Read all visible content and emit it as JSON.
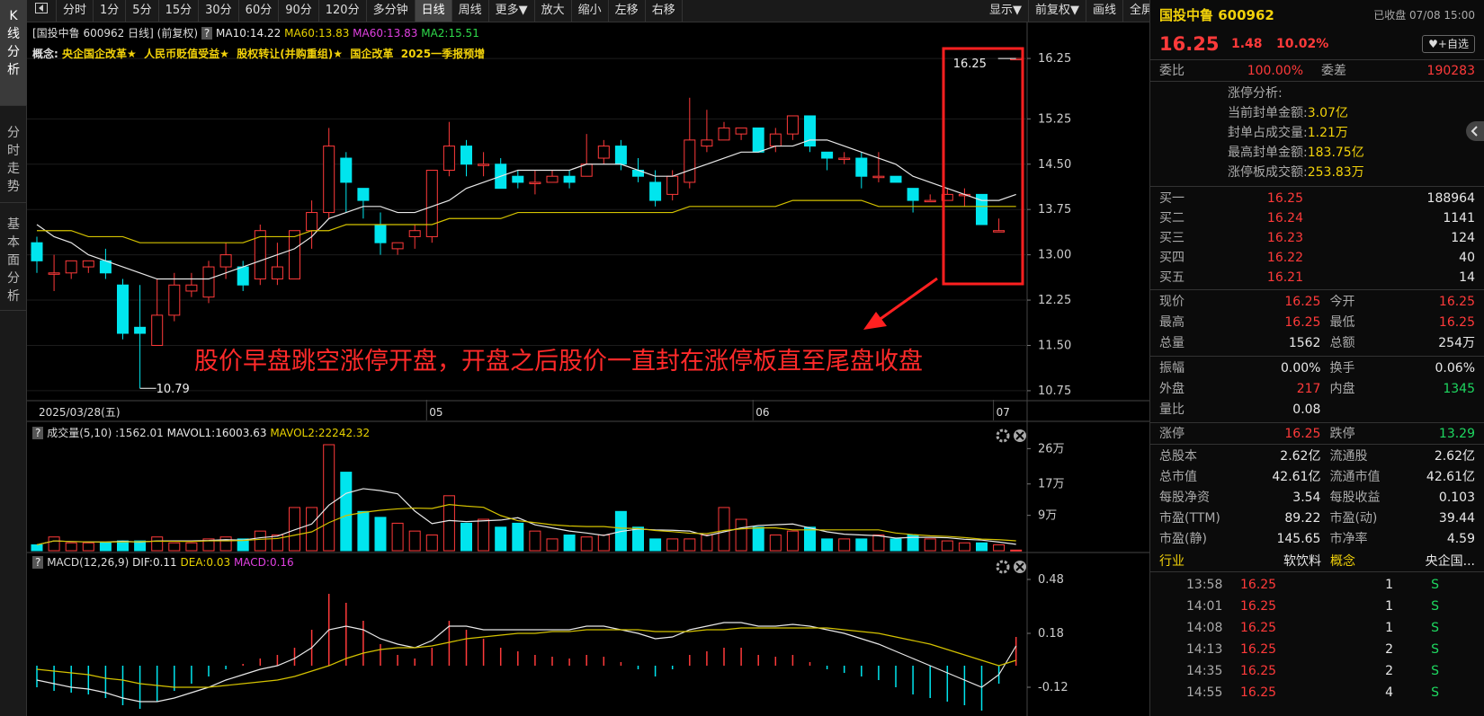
{
  "left_tabs": [
    "K\n线\n分\n析",
    "分\n时\n走\n势",
    "基\n本\n面\n分\n析"
  ],
  "toolbar": {
    "collapse_icon": "collapse-left-icon",
    "periods": [
      "分时",
      "1分",
      "5分",
      "15分",
      "30分",
      "60分",
      "90分",
      "120分",
      "多分钟",
      "日线",
      "周线",
      "更多▼"
    ],
    "active_period": "日线",
    "tools": [
      "放大",
      "缩小",
      "左移",
      "右移"
    ],
    "right_tools": [
      "显示▼",
      "前复权▼",
      "画线",
      "全屏"
    ]
  },
  "kline_header": {
    "title": "[国投中鲁 600962 日线]",
    "adj": "(前复权)",
    "help": "?",
    "ma10": "MA10:14.22",
    "ma60": "MA60:13.83",
    "ma60b": "MA60:13.83",
    "ma2": "MA2:15.51"
  },
  "concepts": {
    "label": "概念:",
    "items": [
      "央企国企改革★",
      "人民币贬值受益★",
      "股权转让(并购重组)★",
      "国企改革",
      "2025一季报预增"
    ]
  },
  "annotation": "股价早盘跳空涨停开盘，开盘之后股价一直封在涨停板直至尾盘收盘",
  "price_labels": {
    "high": "16.25",
    "low": "10.79"
  },
  "price_axis": [
    "16.25",
    "15.25",
    "14.50",
    "13.75",
    "13.00",
    "12.25",
    "11.50",
    "10.75"
  ],
  "date_axis": {
    "start": "2025/03/28(五)",
    "m1": "05",
    "m2": "06",
    "m3": "07"
  },
  "volume_header": {
    "help": "?",
    "title": "成交量(5,10)",
    "val": ":1562.01",
    "mavol1": "MAVOL1:16003.63",
    "mavol2": "MAVOL2:22242.32"
  },
  "volume_axis": [
    "26万",
    "17万",
    "9万"
  ],
  "macd_header": {
    "help": "?",
    "title": "MACD(12,26,9)",
    "dif": "DIF:0.11",
    "dea": "DEA:0.03",
    "macd": "MACD:0.16"
  },
  "macd_axis": [
    "0.48",
    "0.18",
    "-0.12"
  ],
  "colors": {
    "up": "#ff3a3a",
    "down": "#00e5ee",
    "ma_white": "#e8e8e8",
    "ma_yellow": "#d4c200",
    "highlight": "#ff2020"
  },
  "chart_data": {
    "type": "candlestick",
    "price_axis": {
      "ylim": [
        10.6,
        16.4
      ],
      "ticks": [
        16.25,
        15.25,
        14.5,
        13.75,
        13.0,
        12.25,
        11.5,
        10.75
      ]
    },
    "candles": [
      [
        13.2,
        12.9,
        13.3,
        12.7
      ],
      [
        12.7,
        12.7,
        13.0,
        12.4
      ],
      [
        12.7,
        12.9,
        12.9,
        12.6
      ],
      [
        12.8,
        12.9,
        12.9,
        12.7
      ],
      [
        12.9,
        12.7,
        13.1,
        12.6
      ],
      [
        12.5,
        11.7,
        12.6,
        11.6
      ],
      [
        11.8,
        11.7,
        12.5,
        10.79
      ],
      [
        11.5,
        12.0,
        12.6,
        11.5
      ],
      [
        12.0,
        12.5,
        12.7,
        11.9
      ],
      [
        12.4,
        12.5,
        12.7,
        12.3
      ],
      [
        12.3,
        12.8,
        12.9,
        12.2
      ],
      [
        12.8,
        13.0,
        13.2,
        12.6
      ],
      [
        12.8,
        12.5,
        12.9,
        12.4
      ],
      [
        12.6,
        13.4,
        13.5,
        12.5
      ],
      [
        12.6,
        12.8,
        13.2,
        12.5
      ],
      [
        12.6,
        13.4,
        13.4,
        12.6
      ],
      [
        13.4,
        13.7,
        13.9,
        13.1
      ],
      [
        13.7,
        14.8,
        15.1,
        13.6
      ],
      [
        14.6,
        14.2,
        14.7,
        13.7
      ],
      [
        14.1,
        13.9,
        14.1,
        13.6
      ],
      [
        13.5,
        13.2,
        13.7,
        13.0
      ],
      [
        13.1,
        13.2,
        13.2,
        13.0
      ],
      [
        13.3,
        13.4,
        13.5,
        13.1
      ],
      [
        13.3,
        14.4,
        14.4,
        13.2
      ],
      [
        14.4,
        14.8,
        15.2,
        14.3
      ],
      [
        14.8,
        14.5,
        14.9,
        14.3
      ],
      [
        14.5,
        14.5,
        14.7,
        14.3
      ],
      [
        14.5,
        14.1,
        14.6,
        14.1
      ],
      [
        14.3,
        14.2,
        14.4,
        14.1
      ],
      [
        14.2,
        14.2,
        14.4,
        14.0
      ],
      [
        14.2,
        14.3,
        14.4,
        14.2
      ],
      [
        14.3,
        14.2,
        14.4,
        14.1
      ],
      [
        14.3,
        14.5,
        15.0,
        14.3
      ],
      [
        14.6,
        14.8,
        14.9,
        14.5
      ],
      [
        14.8,
        14.5,
        14.9,
        14.4
      ],
      [
        14.4,
        14.3,
        14.6,
        14.2
      ],
      [
        14.2,
        13.9,
        14.4,
        13.8
      ],
      [
        14.0,
        14.3,
        14.4,
        13.9
      ],
      [
        14.2,
        14.9,
        15.6,
        14.1
      ],
      [
        14.8,
        14.9,
        15.4,
        14.7
      ],
      [
        14.9,
        15.1,
        15.2,
        14.9
      ],
      [
        15.0,
        15.1,
        15.1,
        14.9
      ],
      [
        15.1,
        14.7,
        15.1,
        14.7
      ],
      [
        14.8,
        15.0,
        15.1,
        14.7
      ],
      [
        15.0,
        15.3,
        15.3,
        14.9
      ],
      [
        15.3,
        14.8,
        15.3,
        14.7
      ],
      [
        14.7,
        14.6,
        14.7,
        14.4
      ],
      [
        14.6,
        14.6,
        14.7,
        14.5
      ],
      [
        14.6,
        14.3,
        14.7,
        14.1
      ],
      [
        14.3,
        14.3,
        14.7,
        14.2
      ],
      [
        14.3,
        14.2,
        14.3,
        14.2
      ],
      [
        14.1,
        13.9,
        14.1,
        13.7
      ],
      [
        13.9,
        13.9,
        14.0,
        13.9
      ],
      [
        13.9,
        14.0,
        14.1,
        13.9
      ],
      [
        14.0,
        14.0,
        14.1,
        13.8
      ],
      [
        14.0,
        13.5,
        14.0,
        13.5
      ],
      [
        13.4,
        13.4,
        13.6,
        13.4
      ],
      [
        16.25,
        16.25,
        16.25,
        16.25
      ]
    ],
    "volume_axis": {
      "ylim": [
        0,
        270000
      ],
      "ticks": [
        260000,
        170000,
        90000
      ]
    },
    "volumes": [
      15000,
      35000,
      20000,
      20000,
      20000,
      25000,
      25000,
      35000,
      20000,
      20000,
      30000,
      35000,
      30000,
      50000,
      40000,
      110000,
      110000,
      270000,
      200000,
      100000,
      85000,
      70000,
      50000,
      40000,
      140000,
      70000,
      80000,
      60000,
      70000,
      50000,
      30000,
      40000,
      35000,
      40000,
      100000,
      60000,
      30000,
      30000,
      30000,
      40000,
      110000,
      80000,
      60000,
      40000,
      50000,
      60000,
      30000,
      30000,
      30000,
      40000,
      30000,
      40000,
      30000,
      25000,
      20000,
      20000,
      15000,
      1562
    ],
    "ma_white": [
      13.5,
      13.3,
      13.2,
      13.0,
      12.9,
      12.8,
      12.7,
      12.6,
      12.6,
      12.6,
      12.6,
      12.7,
      12.8,
      12.9,
      13.0,
      13.1,
      13.3,
      13.6,
      13.7,
      13.8,
      13.8,
      13.7,
      13.7,
      13.8,
      13.9,
      14.1,
      14.2,
      14.3,
      14.4,
      14.4,
      14.4,
      14.4,
      14.5,
      14.5,
      14.5,
      14.4,
      14.3,
      14.3,
      14.4,
      14.5,
      14.6,
      14.7,
      14.7,
      14.8,
      14.8,
      14.9,
      14.9,
      14.8,
      14.7,
      14.6,
      14.5,
      14.3,
      14.2,
      14.1,
      14.0,
      13.9,
      13.9,
      14.0
    ],
    "ma_yellow": [
      13.4,
      13.4,
      13.4,
      13.3,
      13.3,
      13.3,
      13.2,
      13.2,
      13.2,
      13.2,
      13.2,
      13.2,
      13.2,
      13.3,
      13.3,
      13.3,
      13.4,
      13.4,
      13.5,
      13.5,
      13.5,
      13.5,
      13.5,
      13.5,
      13.6,
      13.6,
      13.6,
      13.6,
      13.7,
      13.7,
      13.7,
      13.7,
      13.7,
      13.7,
      13.7,
      13.7,
      13.7,
      13.7,
      13.8,
      13.8,
      13.8,
      13.8,
      13.8,
      13.8,
      13.9,
      13.9,
      13.9,
      13.9,
      13.9,
      13.8,
      13.8,
      13.8,
      13.8,
      13.8,
      13.8,
      13.8,
      13.8,
      13.8
    ],
    "macd_axis": {
      "ylim": [
        -0.27,
        0.55
      ],
      "ticks": [
        0.48,
        0.18,
        -0.12
      ]
    },
    "macd_hist": [
      -0.12,
      -0.14,
      -0.15,
      -0.16,
      -0.18,
      -0.22,
      -0.24,
      -0.2,
      -0.14,
      -0.1,
      -0.06,
      -0.02,
      0.01,
      0.04,
      0.06,
      0.1,
      0.2,
      0.4,
      0.35,
      0.25,
      0.12,
      0.06,
      0.04,
      0.1,
      0.25,
      0.2,
      0.15,
      0.1,
      0.08,
      0.06,
      0.05,
      0.04,
      0.06,
      0.05,
      0.02,
      -0.02,
      -0.06,
      -0.02,
      0.06,
      0.08,
      0.1,
      0.1,
      0.06,
      0.05,
      0.06,
      0.02,
      -0.02,
      -0.04,
      -0.06,
      -0.08,
      -0.12,
      -0.16,
      -0.18,
      -0.2,
      -0.22,
      -0.25,
      -0.1,
      0.16
    ],
    "macd_dif": [
      -0.08,
      -0.1,
      -0.12,
      -0.13,
      -0.15,
      -0.18,
      -0.2,
      -0.2,
      -0.18,
      -0.15,
      -0.12,
      -0.08,
      -0.05,
      -0.02,
      0.0,
      0.04,
      0.1,
      0.2,
      0.22,
      0.2,
      0.15,
      0.12,
      0.1,
      0.14,
      0.22,
      0.22,
      0.2,
      0.2,
      0.2,
      0.2,
      0.2,
      0.2,
      0.22,
      0.22,
      0.2,
      0.18,
      0.15,
      0.16,
      0.2,
      0.22,
      0.24,
      0.24,
      0.22,
      0.22,
      0.23,
      0.22,
      0.2,
      0.18,
      0.15,
      0.12,
      0.08,
      0.04,
      0.0,
      -0.04,
      -0.08,
      -0.12,
      -0.05,
      0.11
    ],
    "macd_dea": [
      -0.02,
      -0.03,
      -0.04,
      -0.05,
      -0.07,
      -0.08,
      -0.1,
      -0.11,
      -0.12,
      -0.12,
      -0.12,
      -0.11,
      -0.1,
      -0.09,
      -0.08,
      -0.06,
      -0.03,
      0.0,
      0.04,
      0.07,
      0.09,
      0.1,
      0.1,
      0.11,
      0.13,
      0.15,
      0.16,
      0.17,
      0.18,
      0.18,
      0.19,
      0.19,
      0.2,
      0.2,
      0.2,
      0.2,
      0.19,
      0.19,
      0.19,
      0.2,
      0.2,
      0.21,
      0.21,
      0.21,
      0.21,
      0.21,
      0.21,
      0.2,
      0.19,
      0.18,
      0.16,
      0.14,
      0.12,
      0.09,
      0.06,
      0.03,
      0.0,
      0.03
    ]
  },
  "quote": {
    "name_code": "国投中鲁 600962",
    "status": "已收盘 07/08 15:00",
    "price": "16.25",
    "change": "1.48",
    "pct": "10.02%",
    "fav": "♥+自选",
    "weibi_label": "委比",
    "weibi": "100.00%",
    "weicha_label": "委差",
    "weicha": "190283",
    "limit_title": "涨停分析:",
    "limit_rows": [
      {
        "k": "当前封单金额:",
        "v": "3.07亿"
      },
      {
        "k": "封单占成交量:",
        "v": "1.21万"
      },
      {
        "k": "最高封单金额:",
        "v": "183.75亿"
      },
      {
        "k": "涨停板成交额:",
        "v": "253.83万"
      }
    ],
    "bids": [
      {
        "label": "买一",
        "price": "16.25",
        "vol": "188964"
      },
      {
        "label": "买二",
        "price": "16.24",
        "vol": "1141"
      },
      {
        "label": "买三",
        "price": "16.23",
        "vol": "124"
      },
      {
        "label": "买四",
        "price": "16.22",
        "vol": "40"
      },
      {
        "label": "买五",
        "price": "16.21",
        "vol": "14"
      }
    ],
    "stats1": [
      {
        "k1": "现价",
        "v1": "16.25",
        "c1": "red",
        "k2": "今开",
        "v2": "16.25",
        "c2": "red"
      },
      {
        "k1": "最高",
        "v1": "16.25",
        "c1": "red",
        "k2": "最低",
        "v2": "16.25",
        "c2": "red"
      },
      {
        "k1": "总量",
        "v1": "1562",
        "c1": "white",
        "k2": "总额",
        "v2": "254万",
        "c2": "white"
      }
    ],
    "stats2": [
      {
        "k1": "振幅",
        "v1": "0.00%",
        "c1": "white",
        "k2": "换手",
        "v2": "0.06%",
        "c2": "white"
      },
      {
        "k1": "外盘",
        "v1": "217",
        "c1": "red",
        "k2": "内盘",
        "v2": "1345",
        "c2": "green"
      },
      {
        "k1": "量比",
        "v1": "0.08",
        "c1": "white",
        "k2": "",
        "v2": "",
        "c2": "white"
      }
    ],
    "limits": {
      "k1": "涨停",
      "v1": "16.25",
      "k2": "跌停",
      "v2": "13.29"
    },
    "stats3": [
      {
        "k1": "总股本",
        "v1": "2.62亿",
        "c1": "white",
        "k2": "流通股",
        "v2": "2.62亿",
        "c2": "white"
      },
      {
        "k1": "总市值",
        "v1": "42.61亿",
        "c1": "white",
        "k2": "流通市值",
        "v2": "42.61亿",
        "c2": "white"
      },
      {
        "k1": "每股净资",
        "v1": "3.54",
        "c1": "white",
        "k2": "每股收益",
        "v2": "0.103",
        "c2": "white"
      },
      {
        "k1": "市盈(TTM)",
        "v1": "89.22",
        "c1": "white",
        "k2": "市盈(动)",
        "v2": "39.44",
        "c2": "white"
      },
      {
        "k1": "市盈(静)",
        "v1": "145.65",
        "c1": "white",
        "k2": "市净率",
        "v2": "4.59",
        "c2": "white"
      }
    ],
    "industry": {
      "k1": "行业",
      "v1": "软饮料",
      "k2": "概念",
      "v2": "央企国..."
    },
    "ticks": [
      {
        "t": "13:58",
        "p": "16.25",
        "q": "1",
        "s": "S"
      },
      {
        "t": "14:01",
        "p": "16.25",
        "q": "1",
        "s": "S"
      },
      {
        "t": "14:08",
        "p": "16.25",
        "q": "1",
        "s": "S"
      },
      {
        "t": "14:13",
        "p": "16.25",
        "q": "2",
        "s": "S"
      },
      {
        "t": "14:35",
        "p": "16.25",
        "q": "2",
        "s": "S"
      },
      {
        "t": "14:55",
        "p": "16.25",
        "q": "4",
        "s": "S"
      }
    ],
    "side_collapse_icon": "chevron-left-icon"
  }
}
